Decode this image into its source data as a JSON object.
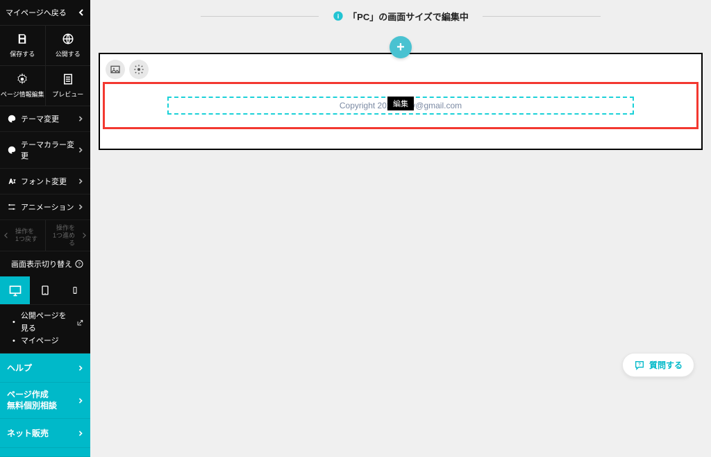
{
  "sidebar": {
    "back_label": "マイページへ戻る",
    "save_label": "保存する",
    "publish_label": "公開する",
    "pageinfo_label": "ページ情報編集",
    "preview_label": "プレビュー",
    "theme_label": "テーマ変更",
    "theme_color_label": "テーマカラー変更",
    "font_label": "フォント変更",
    "animation_label": "アニメーション",
    "undo_line1": "操作を",
    "undo_line2": "1つ戻す",
    "redo_line1": "操作を",
    "redo_line2": "1つ進める",
    "display_toggle_label": "画面表示切り替え",
    "link_published": "公開ページを見る",
    "link_mypage": "マイページ",
    "help_label": "ヘルプ",
    "consult_line1": "ページ作成",
    "consult_line2": "無料個別相談",
    "net_sales_label": "ネット販売"
  },
  "topbar": {
    "message": "「PC」の画面サイズで編集中"
  },
  "canvas": {
    "edit_chip": "編集",
    "copyright_text": "Copyright 2023           adily@gmail.com"
  },
  "ask": {
    "label": "質問する"
  },
  "colors": {
    "teal": "#00b9c9"
  }
}
